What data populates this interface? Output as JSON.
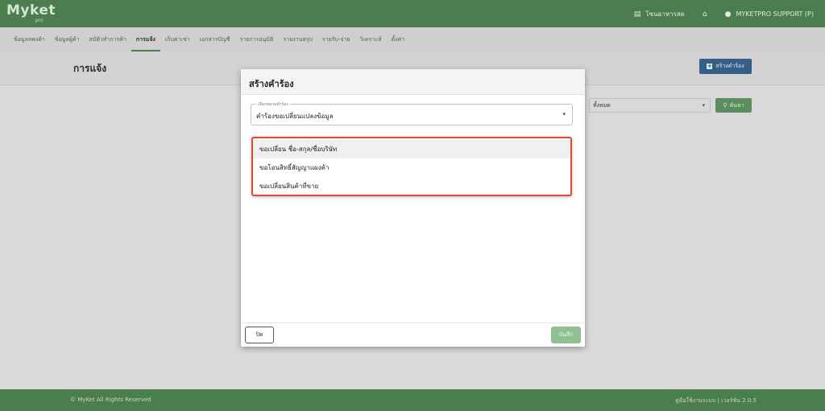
{
  "app": {
    "logo": "Myket",
    "logo_sub": "pro",
    "top_right": {
      "shop_label": "โซนอาหารสด",
      "user_label": "MYKETPRO SUPPORT (P)"
    }
  },
  "nav": {
    "items": [
      {
        "label": "ข้อมูลลพงค้า"
      },
      {
        "label": "ข้อมูลผู้ค้า"
      },
      {
        "label": "สมัตัวทำการค้า"
      },
      {
        "label": "การแจ้ง"
      },
      {
        "label": "เก็บค่าเช่า"
      },
      {
        "label": "เอกสารบัญชี"
      },
      {
        "label": "รายการอนุมัติ"
      },
      {
        "label": "รายงานสรุป"
      },
      {
        "label": "รายรับ-จ่าย"
      },
      {
        "label": "วิเคราะห์"
      },
      {
        "label": "ตั้งค่า"
      }
    ],
    "active_index": 3
  },
  "page": {
    "title": "การแจ้ง",
    "create_button": "สร้างคำร้อง",
    "filter_value": "ทั้งหมด",
    "search_button": "ค้นหา"
  },
  "modal": {
    "title": "สร้างคำร้อง",
    "field_label": "เลือกหมวดคำร้อง",
    "field_value": "คำร้องขอเปลี่ยนแปลงข้อมูล",
    "options": [
      {
        "label": "ขอเปลี่ยน ชื่อ-สกุล/ชื่อบริษัท"
      },
      {
        "label": "ขอโอนสิทธิ์สัญญาแผงค้า"
      },
      {
        "label": "ขอเปลี่ยนสินค้าที่ขาย"
      }
    ],
    "close_button": "ปิด",
    "save_button": "บันทึก"
  },
  "footer": {
    "copyright": "© MyKet All Rights Reserved",
    "right_text": "คู่มือใช้งานระบบ | เวอร์ชัน 2.0.5"
  },
  "colors": {
    "brand_green": "#4b7d4f",
    "primary_blue": "#355f86",
    "highlight_red": "#e0492e",
    "save_green": "#8ec18f"
  }
}
